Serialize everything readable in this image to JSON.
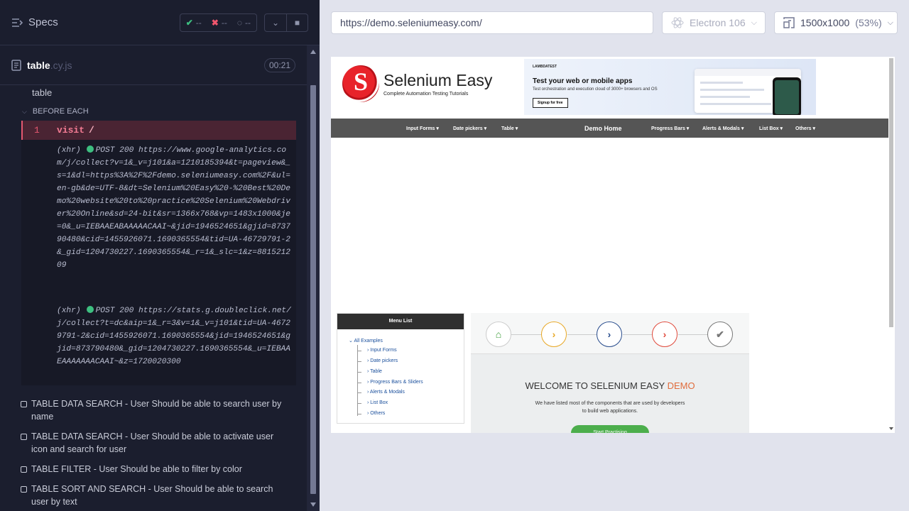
{
  "reporter": {
    "header": {
      "title": "Specs",
      "passed": "--",
      "failed": "--",
      "pending": "--"
    },
    "file": {
      "name": "table",
      "ext": ".cy.js",
      "duration": "00:21"
    },
    "suite_name": "table",
    "hook": "BEFORE EACH",
    "command": {
      "num": "1",
      "name": "visit",
      "arg": "/"
    },
    "logs": [
      {
        "tag": "(xhr)",
        "status": "POST 200",
        "url": "https://www.google-analytics.com/j/collect?v=1&_v=j101&a=1210185394&t=pageview&_s=1&dl=https%3A%2F%2Fdemo.seleniumeasy.com%2F&ul=en-gb&de=UTF-8&dt=Selenium%20Easy%20-%20Best%20Demo%20website%20to%20practice%20Selenium%20Webdriver%20Online&sd=24-bit&sr=1366x768&vp=1483x1000&je=0&_u=IEBAAEABAAAAACAAI~&jid=1946524651&gjid=873790480&cid=1455926071.1690365554&tid=UA-46729791-2&_gid=1204730227.1690365554&_r=1&_slc=1&z=881521209"
      },
      {
        "tag": "(xhr)",
        "status": "POST 200",
        "url": "https://stats.g.doubleclick.net/j/collect?t=dc&aip=1&_r=3&v=1&_v=j101&tid=UA-46729791-2&cid=1455926071.1690365554&jid=1946524651&gjid=873790480&_gid=1204730227.1690365554&_u=IEBAAEAAAAAAACAAI~&z=1720020300"
      }
    ],
    "tests": [
      "TABLE DATA SEARCH - User Should be able to search user by name",
      "TABLE DATA SEARCH - User Should be able to activate user icon and search for user",
      "TABLE FILTER - User Should be able to filter by color",
      "TABLE SORT AND SEARCH - User Should be able to search user by text"
    ]
  },
  "aut": {
    "url": "https://demo.seleniumeasy.com/",
    "browser": "Electron 106",
    "viewport": "1500x1000",
    "zoom": "(53%)"
  },
  "site": {
    "brand": "Selenium Easy",
    "logo_letter": "S",
    "tagline": "Complete Automation Testing Tutorials",
    "ad": {
      "logo_text": "LAMBDATEST",
      "headline": "Test your web or mobile apps",
      "sub": "Test orchestration and execution cloud of 3000+ browsers and OS",
      "button": "Signup for free"
    },
    "nav": [
      "Input Forms ▾",
      "Date pickers ▾",
      "Table ▾",
      "Demo Home",
      "Progress Bars ▾",
      "Alerts & Modals ▾",
      "List Box ▾",
      "Others ▾"
    ],
    "menu": {
      "title": "Menu List",
      "root": "All Examples",
      "items": [
        "Input Forms",
        "Date pickers",
        "Table",
        "Progress Bars & Sliders",
        "Alerts & Modals",
        "List Box",
        "Others"
      ]
    },
    "welcome": {
      "prefix": "WELCOME TO SELENIUM EASY ",
      "accent": "DEMO"
    },
    "desc": "We have listed most of the components that are used by developers to build web applications.",
    "start_button": "Start Practising"
  }
}
